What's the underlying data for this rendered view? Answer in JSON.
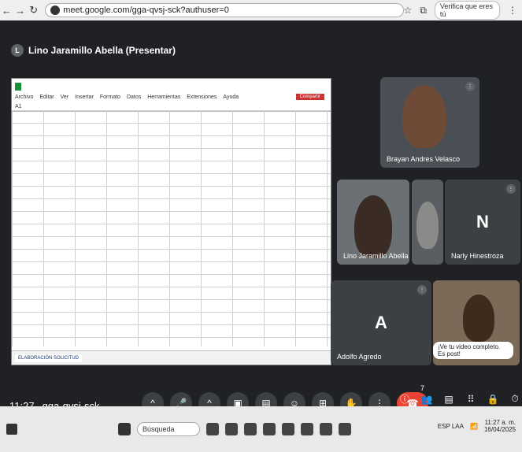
{
  "browser": {
    "url": "meet.google.com/gga-qvsj-sck?authuser=0",
    "chip_label": "Verifica que eres tú",
    "nav_icons": [
      "back-icon",
      "forward-icon",
      "reload-icon"
    ]
  },
  "meet": {
    "presenter_label": "Lino Jaramillo Abella (Presentar)",
    "presenter_initial": "L",
    "participants": [
      {
        "name": "Brayan Andres Velasco",
        "letter": ""
      },
      {
        "name": "Lino Jaramillo Abella",
        "letter": ""
      },
      {
        "name": "",
        "letter": ""
      },
      {
        "name": "Narly Hinestroza",
        "letter": "N"
      },
      {
        "name": "Adolfo Agredo",
        "letter": "A"
      },
      {
        "name": "",
        "letter": ""
      }
    ],
    "caption_text": "¡Ve tu video completo. Es post!",
    "time": "11:27",
    "meeting_code": "gga-qvsj-sck",
    "people_count": "7"
  },
  "sheet": {
    "title": "",
    "menu": [
      "Archivo",
      "Editar",
      "Ver",
      "Insertar",
      "Formato",
      "Datos",
      "Herramientas",
      "Extensiones",
      "Ayuda"
    ],
    "share_label": "Compartir",
    "formula_ref": "A1",
    "tabs": [
      "ELABORACIÓN SOLICITUD",
      "",
      "",
      ""
    ]
  },
  "taskbar": {
    "search_placeholder": "Búsqueda",
    "clock_time": "11:27 a. m.",
    "clock_date": "16/04/2025",
    "lang": "ESP LAA"
  }
}
